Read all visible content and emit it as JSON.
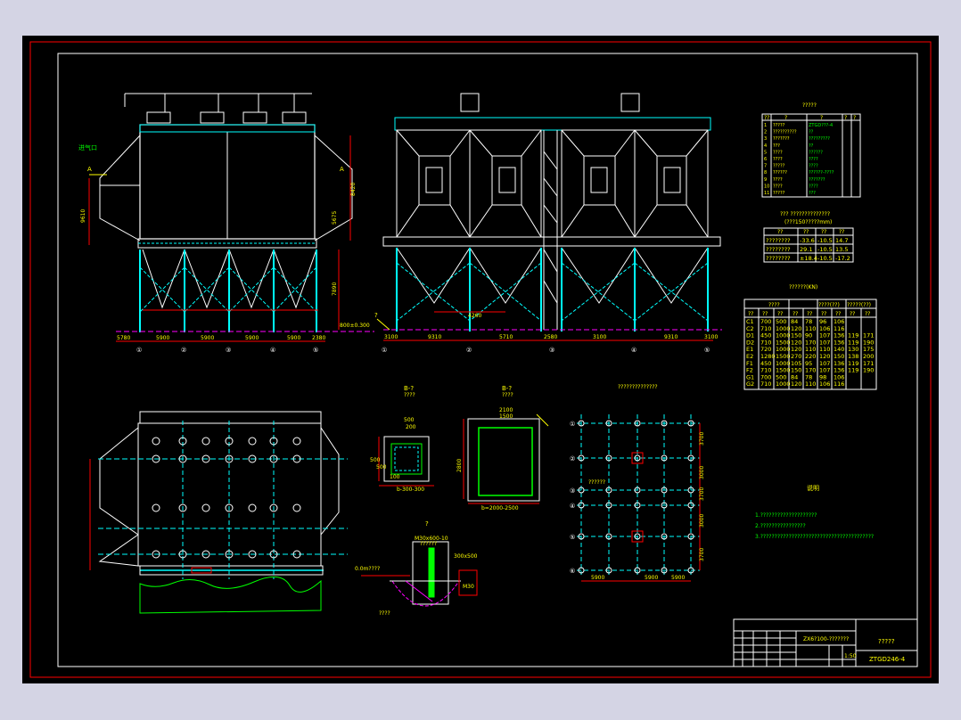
{
  "front_view": {
    "label_left": "A",
    "label_right": "A",
    "label_tag": "进气口",
    "dims_bottom": [
      "5780",
      "5900",
      "5900",
      "5900",
      "5900",
      "2380"
    ],
    "axis_bubbles": [
      "①",
      "②",
      "③",
      "④",
      "⑤"
    ],
    "dims_vertical": [
      "9610",
      "8420",
      "5675",
      "7890"
    ],
    "elev_label": "800±0.300"
  },
  "side_view": {
    "callout": "?",
    "dims_bottom": [
      "3100",
      "9310",
      "5710",
      "2580",
      "3100",
      "9310",
      "3100"
    ],
    "axis_bubbles": [
      "①",
      "②",
      "③",
      "④",
      "⑤"
    ],
    "dim_mid": "4260"
  },
  "param_table": {
    "title": "?????",
    "header": [
      "??",
      "?",
      "?",
      "?",
      "?"
    ],
    "rows": [
      [
        "1",
        "?????",
        "ZTGD???-4",
        "",
        ""
      ],
      [
        "2",
        "??????????",
        "??",
        "",
        ""
      ],
      [
        "3",
        "???????",
        "?????????",
        "",
        ""
      ],
      [
        "4",
        "???",
        "??",
        "",
        ""
      ],
      [
        "5",
        "????",
        "??????",
        "",
        ""
      ],
      [
        "6",
        "????",
        "????",
        "",
        ""
      ],
      [
        "7",
        "?????",
        "????",
        "",
        ""
      ],
      [
        "8",
        "??????",
        "??????-????",
        "",
        ""
      ],
      [
        "9",
        "????",
        "???????",
        "",
        ""
      ],
      [
        "10",
        "????",
        "????",
        "",
        ""
      ],
      [
        "11",
        "?????",
        "???",
        "",
        ""
      ]
    ]
  },
  "pressure_table": {
    "title": "??? ??????????????",
    "subtitle": "(???150?????mm)",
    "header": [
      "??",
      "??",
      "??",
      "??"
    ],
    "rows": [
      [
        "????????",
        "-33.6",
        "-10.5",
        "14.7"
      ],
      [
        "????????",
        "29.1",
        "-10.5",
        "13.5"
      ],
      [
        "????????",
        "±18.4",
        "-10.5",
        "-17.2"
      ]
    ]
  },
  "load_table": {
    "title": "??????(KN)",
    "group1": "????",
    "group2": "????(??)",
    "group3": "?????(??)",
    "header": [
      "??",
      "??",
      "??",
      "??",
      "??",
      "??",
      "??",
      "??",
      "??"
    ],
    "rows": [
      [
        "C1",
        "700",
        "500",
        "84",
        "78",
        "96",
        "106",
        "",
        ""
      ],
      [
        "C2",
        "710",
        "1000",
        "120",
        "110",
        "106",
        "116",
        "",
        ""
      ],
      [
        "D1",
        "450",
        "1000",
        "150",
        "90",
        "107",
        "136",
        "119",
        "171"
      ],
      [
        "D2",
        "710",
        "1500",
        "120",
        "170",
        "107",
        "136",
        "119",
        "190"
      ],
      [
        "E1",
        "720",
        "1000",
        "120",
        "110",
        "110",
        "140",
        "130",
        "175"
      ],
      [
        "E2",
        "1280",
        "1500",
        "270",
        "220",
        "120",
        "150",
        "138",
        "200"
      ],
      [
        "F1",
        "450",
        "1000",
        "105",
        "95",
        "107",
        "136",
        "119",
        "171"
      ],
      [
        "F2",
        "710",
        "1500",
        "150",
        "170",
        "107",
        "136",
        "119",
        "190"
      ],
      [
        "G1",
        "700",
        "500",
        "84",
        "78",
        "98",
        "106",
        "",
        ""
      ],
      [
        "G2",
        "710",
        "1000",
        "120",
        "110",
        "106",
        "116",
        "",
        ""
      ]
    ]
  },
  "details": {
    "section1_title": "B-?",
    "section1_sub": "????",
    "section1_dims": [
      "500",
      "200",
      "500",
      "500",
      "100",
      "b-300-300"
    ],
    "section2_title": "B-?",
    "section2_sub": "????",
    "section2_dims": [
      "2100",
      "1500",
      "2800",
      "b=2000-2500"
    ],
    "anchor_title": "?",
    "anchor_labels": [
      "M30x600-10",
      "300x500",
      "0.0m????",
      "????",
      "??????",
      "M30"
    ],
    "foundation_title": "??????????????"
  },
  "foundation_plan": {
    "rows": [
      "①",
      "②",
      "③",
      "④",
      "⑤",
      "⑥"
    ],
    "dims_bottom": [
      "5900",
      "5900",
      "5900"
    ],
    "dims_right": [
      "3700",
      "3000",
      "3700",
      "3000",
      "3700"
    ],
    "notes_label": "??????"
  },
  "notes": {
    "title": "说明",
    "lines": [
      "1.????????????????????",
      "2.????????????????",
      "3.????????????????????????????????????????"
    ]
  },
  "title_block": {
    "project": "ZX6?100-???????",
    "drawing_name": "?????",
    "drawing_no": "ZTGD246-4",
    "scale": "1:50"
  },
  "colors": {
    "background": "#000000",
    "border": "#ff0000",
    "frame": "#ffffff",
    "steel": "#00ffff",
    "dim": "#ff0000",
    "text": "#ffff00",
    "accent": "#00ff00",
    "magenta": "#ff00ff"
  }
}
